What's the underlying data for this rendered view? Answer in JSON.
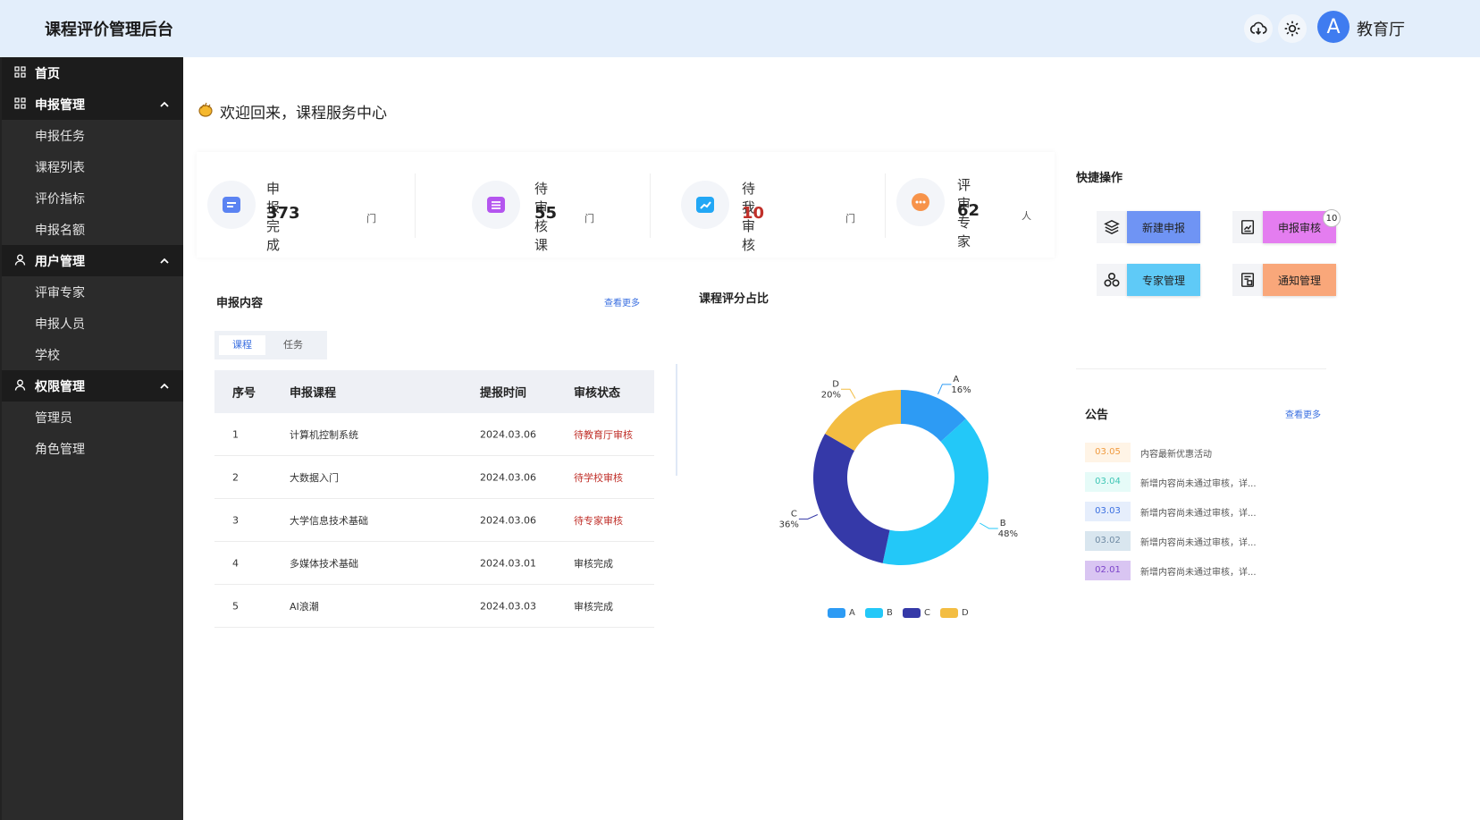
{
  "header": {
    "title": "课程评价管理后台",
    "avatar_letter": "A",
    "user_name": "教育厅",
    "icons": [
      "cloud-download-icon",
      "sun-icon"
    ]
  },
  "sidebar": {
    "items": [
      {
        "label": "首页",
        "type": "parent",
        "icon": "grid-icon"
      },
      {
        "label": "申报管理",
        "type": "parent",
        "icon": "grid-icon",
        "expanded": true
      },
      {
        "label": "申报任务",
        "type": "child"
      },
      {
        "label": "课程列表",
        "type": "child"
      },
      {
        "label": "评价指标",
        "type": "child"
      },
      {
        "label": "申报名额",
        "type": "child"
      },
      {
        "label": "用户管理",
        "type": "parent",
        "icon": "user-icon",
        "expanded": true
      },
      {
        "label": "评审专家",
        "type": "child"
      },
      {
        "label": "申报人员",
        "type": "child"
      },
      {
        "label": "学校",
        "type": "child"
      },
      {
        "label": "权限管理",
        "type": "parent",
        "icon": "user-icon",
        "expanded": true
      },
      {
        "label": "管理员",
        "type": "child"
      },
      {
        "label": "角色管理",
        "type": "child"
      }
    ]
  },
  "welcome": {
    "text": "欢迎回来，课程服务中心"
  },
  "stats": [
    {
      "label": "申报完成",
      "value": "373",
      "unit": "门",
      "color": "#4a78f0"
    },
    {
      "label": "待审核课",
      "value": "55",
      "unit": "门",
      "color": "#b34ff0"
    },
    {
      "label": "待我审核",
      "value": "10",
      "unit": "门",
      "color": "#1ea6f5"
    },
    {
      "label": "评审专家",
      "value": "62",
      "unit": "人",
      "color": "#f7934a"
    }
  ],
  "submissions": {
    "title": "申报内容",
    "more": "查看更多",
    "tabs": [
      "课程",
      "任务"
    ],
    "columns": [
      "序号",
      "申报课程",
      "提报时间",
      "审核状态"
    ],
    "rows": [
      {
        "no": "1",
        "course": "计算机控制系统",
        "date": "2024.03.06",
        "status": "待教育厅审核",
        "pending": true
      },
      {
        "no": "2",
        "course": "大数据入门",
        "date": "2024.03.06",
        "status": "待学校审核",
        "pending": true
      },
      {
        "no": "3",
        "course": "大学信息技术基础",
        "date": "2024.03.06",
        "status": "待专家审核",
        "pending": true
      },
      {
        "no": "4",
        "course": "多媒体技术基础",
        "date": "2024.03.01",
        "status": "审核完成",
        "pending": false
      },
      {
        "no": "5",
        "course": "AI浪潮",
        "date": "2024.03.03",
        "status": "审核完成",
        "pending": false
      }
    ]
  },
  "chart_data": {
    "type": "pie",
    "title": "课程评分占比",
    "categories": [
      "A",
      "B",
      "C",
      "D"
    ],
    "values": [
      16,
      48,
      36,
      20
    ],
    "labels": [
      "16%",
      "48%",
      "36%",
      "20%"
    ],
    "colors": [
      "#2d9bf4",
      "#23c8f8",
      "#3539a8",
      "#f3bd42"
    ],
    "donut": true,
    "legend": "bottom"
  },
  "quick_actions": {
    "title": "快捷操作",
    "items": [
      {
        "label": "新建申报",
        "icon": "layers-icon",
        "color": "#6f94f4"
      },
      {
        "label": "申报审核",
        "icon": "chart-doc-icon",
        "color": "#e47df0",
        "badge": "10"
      },
      {
        "label": "专家管理",
        "icon": "users-triangle-icon",
        "color": "#5fcaf7"
      },
      {
        "label": "通知管理",
        "icon": "notice-doc-icon",
        "color": "#f9a77a"
      }
    ]
  },
  "notices": {
    "title": "公告",
    "more": "查看更多",
    "items": [
      {
        "date": "03.05",
        "text": "内容最新优惠活动",
        "bg": "#fff4e6",
        "fg": "#f09a3e"
      },
      {
        "date": "03.04",
        "text": "新增内容尚未通过审核，详...",
        "bg": "#e6fbf8",
        "fg": "#3fc6b5"
      },
      {
        "date": "03.03",
        "text": "新增内容尚未通过审核，详...",
        "bg": "#e6eefc",
        "fg": "#3a6fe0"
      },
      {
        "date": "03.02",
        "text": "新增内容尚未通过审核，详...",
        "bg": "#d9e6ef",
        "fg": "#6f8aa3"
      },
      {
        "date": "02.01",
        "text": "新增内容尚未通过审核，详...",
        "bg": "#d9c5f2",
        "fg": "#7b43c9"
      }
    ]
  }
}
